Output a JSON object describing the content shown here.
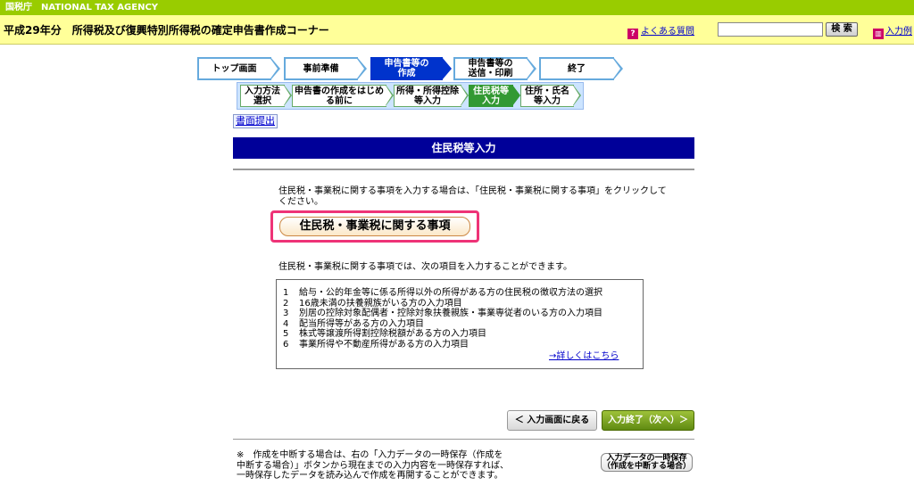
{
  "header": {
    "agency": "国税庁　NATIONAL TAX AGENCY",
    "title": "平成29年分　所得税及び復興特別所得税の確定申告書作成コーナー",
    "faq_label": "よくある質問",
    "faq_icon": "?",
    "search_placeholder": "",
    "search_button": "検 索",
    "example_label": "入力例"
  },
  "steps": [
    {
      "label": "トップ画面"
    },
    {
      "label": "事前準備"
    },
    {
      "label": "申告書等の\n作成"
    },
    {
      "label": "申告書等の\n送信・印刷"
    },
    {
      "label": "終了"
    }
  ],
  "substeps": [
    {
      "label": "入力方法\n選択"
    },
    {
      "label": "申告書の作成をはじめ\nる前に"
    },
    {
      "label": "所得・所得控除\n等入力"
    },
    {
      "label": "住民税等\n入力"
    },
    {
      "label": "住所・氏名\n等入力"
    }
  ],
  "submit_link": "書面提出",
  "section_title": "住民税等入力",
  "intro_text": "住民税・事業税に関する事項を入力する場合は、「住民税・事業税に関する事項」をクリックしてください。",
  "main_link": "住民税・事業税に関する事項",
  "items_intro": "住民税・事業税に関する事項では、次の項目を入力することができます。",
  "items": [
    {
      "num": "1",
      "text": "給与・公的年金等に係る所得以外の所得がある方の住民税の徴収方法の選択"
    },
    {
      "num": "2",
      "text": "16歳未満の扶養親族がいる方の入力項目"
    },
    {
      "num": "3",
      "text": "別居の控除対象配偶者・控除対象扶養親族・事業専従者のいる方の入力項目"
    },
    {
      "num": "4",
      "text": "配当所得等がある方の入力項目"
    },
    {
      "num": "5",
      "text": "株式等譲渡所得割控除税額がある方の入力項目"
    },
    {
      "num": "6",
      "text": "事業所得や不動産所得がある方の入力項目"
    }
  ],
  "detail_link": "→詳しくはこちら",
  "back_button": "＜ 入力画面に戻る",
  "next_button": "入力終了（次へ）＞",
  "footnote": "※　作成を中断する場合は、右の「入力データの一時保存（作成を中断する場合）」ボタンから現在までの入力内容を一時保存すれば、一時保存したデータを読み込んで作成を再開することができます。",
  "save_button_line1": "入力データの一時保存",
  "save_button_line2": "（作成を中断する場合）"
}
